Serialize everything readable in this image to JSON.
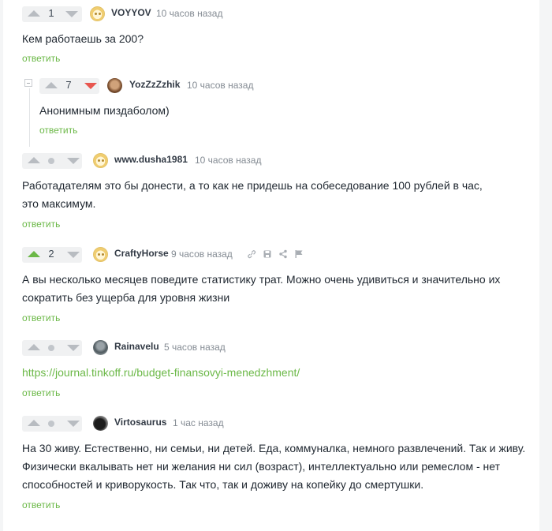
{
  "comments": [
    {
      "score": "1",
      "nick": "VOYYOV",
      "time": "10 часов назад",
      "text": "Кем работаешь за 200?",
      "reply": "ответить"
    },
    {
      "score": "7",
      "nick": "YozZzZzhik",
      "time": "10 часов назад",
      "text": "Анонимным пиздаболом)",
      "reply": "ответить"
    },
    {
      "nick": "www.dusha1981",
      "time": "10 часов назад",
      "text_line1": "Работадателям это бы донести, а то как не придешь на собеседование 100 рублей в час,",
      "text_line2": "это максимум.",
      "reply": "ответить"
    },
    {
      "score": "2",
      "nick": "CraftyHorse",
      "time": "9 часов назад",
      "text_line1": "А вы несколько месяцев поведите статистику трат. Можно очень удивиться и значительно их",
      "text_line2": "сократить без ущерба для уровня жизни",
      "reply": "ответить"
    },
    {
      "nick": "Rainavelu",
      "time": "5 часов назад",
      "link": "https://journal.tinkoff.ru/budget-finansovyi-menedzhment/",
      "reply": "ответить"
    },
    {
      "nick": "Virtosaurus",
      "time": "1 час назад",
      "text_line1": "На 30 живу. Естественно, ни семьи, ни детей. Еда, коммуналка, немного развлечений. Так и живу.",
      "text_line2": "Физически вкалывать нет ни желания ни сил (возраст), интеллектуально или ремеслом  - нет",
      "text_line3": "способностей и криворукость. Так что, так и доживу на копейку до смертушки.",
      "reply": "ответить"
    }
  ],
  "icons": {
    "upvote": "arrow-up-icon",
    "downvote": "arrow-down-icon",
    "link": "link-icon",
    "save": "save-icon",
    "share": "share-icon",
    "report": "flag-icon",
    "collapse": "collapse-branch-icon"
  },
  "colors": {
    "accent": "#6bb847",
    "downvote_active": "#e8564f",
    "muted": "#848b93"
  }
}
